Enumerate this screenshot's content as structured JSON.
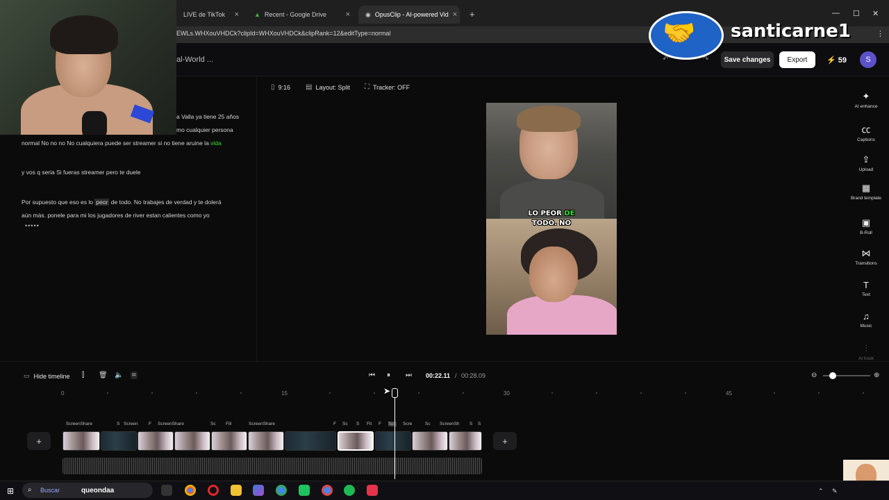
{
  "browser": {
    "tabs": [
      {
        "label": "LIVE de TikTok"
      },
      {
        "label": "Recent - Google Drive"
      },
      {
        "label": "OpusClip - AI-powered Vid"
      }
    ],
    "url": "EWLs.WHXouVHDCk?clipId=WHXouVHDCk&clipRank=12&editType=normal"
  },
  "header": {
    "project_title": "al-World ...",
    "save_label": "Save changes",
    "export_label": "Export",
    "credits": "59",
    "avatar_letter": "S"
  },
  "toolbar": {
    "aspect": "9:16",
    "layout": "Layout: Split",
    "tracker": "Tracker: OFF"
  },
  "transcript": {
    "lines": [
      "a Valla ya tiene 25 años",
      "mo cualquier persona",
      "normal No no no No cualquiera puede ser streamer si no tiene aruine la",
      "vida",
      "y vos q seria Si fueras streamer pero te duele",
      "Por supuesto que eso es lo",
      "peor",
      "de todo. No trabajes de verdad y te dolerá",
      "aún más. ponele para mi  los jugadores de river estan calientes como yo",
      "•••••"
    ]
  },
  "preview": {
    "caption_line1_a": "LO PEOR",
    "caption_line1_b": "DE",
    "caption_line2": "TODO. NO"
  },
  "sidebar": {
    "items": [
      {
        "label": "AI enhance",
        "icon": "sparkle-icon"
      },
      {
        "label": "Captions",
        "icon": "cc-icon"
      },
      {
        "label": "Upload",
        "icon": "upload-icon"
      },
      {
        "label": "Brand template",
        "icon": "grid-icon"
      },
      {
        "label": "B-Roll",
        "icon": "broll-icon"
      },
      {
        "label": "Transitions",
        "icon": "transitions-icon"
      },
      {
        "label": "Text",
        "icon": "text-icon"
      },
      {
        "label": "Music",
        "icon": "music-icon"
      },
      {
        "label": "AI hook",
        "icon": "ai-hook-icon"
      }
    ]
  },
  "timeline": {
    "hide_label": "Hide timeline",
    "current_time": "00:22.11",
    "separator": "/",
    "total_time": "00:28.09",
    "ruler": [
      "0",
      "15",
      "30",
      "45"
    ],
    "clip_labels": [
      "ScreenShare",
      "S",
      "Screen",
      "F",
      "ScreenShare",
      "Sc",
      "Fill",
      "ScreenShare",
      "F",
      "Sc",
      "S",
      "Fit",
      "F",
      "Sp",
      "Scre",
      "Sc",
      "ScreenSh",
      "S",
      "S"
    ]
  },
  "overlay": {
    "channel_name": "santicarne1",
    "taskbar_search": "Buscar",
    "taskbar_user": "queondaa"
  },
  "colors": {
    "accent_green": "#35e23f",
    "avatar_bg": "#5b51c9",
    "badge_blue": "#1f63c6"
  }
}
